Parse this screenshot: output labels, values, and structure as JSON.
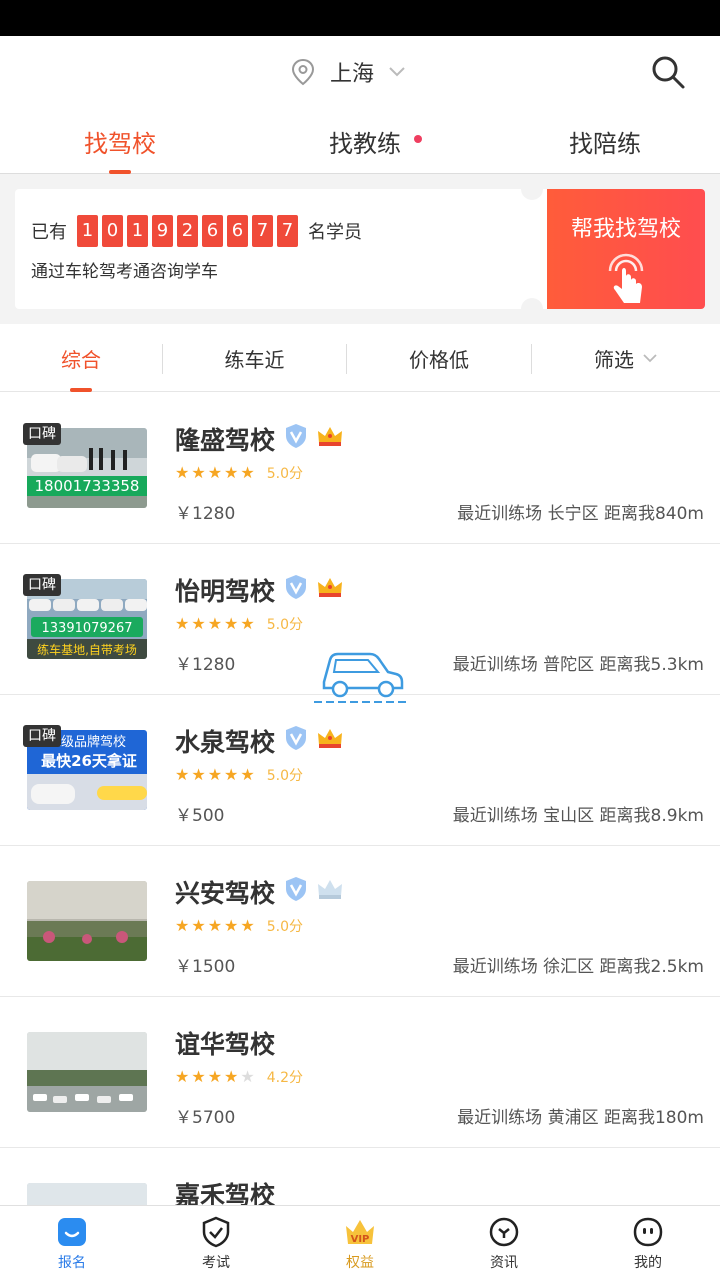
{
  "header": {
    "city": "上海"
  },
  "tabs": [
    {
      "label": "找驾校",
      "active": true
    },
    {
      "label": "找教练",
      "dot": true
    },
    {
      "label": "找陪练"
    }
  ],
  "banner": {
    "prefix": "已有",
    "digits": [
      "1",
      "0",
      "1",
      "9",
      "2",
      "6",
      "6",
      "7",
      "7"
    ],
    "suffix": "名学员",
    "subtitle": "通过车轮驾考通咨询学车",
    "button": "帮我找驾校"
  },
  "filters": [
    "综合",
    "练车近",
    "价格低",
    "筛选"
  ],
  "schools": [
    {
      "name": "隆盛驾校",
      "verified": true,
      "crown": "gold",
      "koubei": "口碑",
      "rating": 5,
      "score": "5.0分",
      "price": "￥1280",
      "location": "最近训练场 长宁区 距离我840m",
      "phone": "18001733358"
    },
    {
      "name": "怡明驾校",
      "verified": true,
      "crown": "gold",
      "koubei": "口碑",
      "rating": 5,
      "score": "5.0分",
      "price": "￥1280",
      "location": "最近训练场 普陀区 距离我5.3km",
      "phone": "13391079267",
      "tagline": "练车基地,自带考场"
    },
    {
      "name": "水泉驾校",
      "verified": true,
      "crown": "gold",
      "koubei": "口碑",
      "rating": 5,
      "score": "5.0分",
      "price": "￥500",
      "location": "最近训练场 宝山区 距离我8.9km",
      "promo1": "A级品牌驾校",
      "promo2": "最快26天拿证"
    },
    {
      "name": "兴安驾校",
      "verified": true,
      "crown": "silver",
      "rating": 5,
      "score": "5.0分",
      "price": "￥1500",
      "location": "最近训练场 徐汇区 距离我2.5km"
    },
    {
      "name": "谊华驾校",
      "rating": 4,
      "score": "4.2分",
      "price": "￥5700",
      "location": "最近训练场 黄浦区 距离我180m"
    },
    {
      "name": "嘉禾驾校"
    }
  ],
  "bottom_nav": [
    {
      "label": "报名",
      "icon": "signup-icon",
      "active": true
    },
    {
      "label": "考试",
      "icon": "exam-shield-icon"
    },
    {
      "label": "权益",
      "icon": "vip-crown-icon"
    },
    {
      "label": "资讯",
      "icon": "news-icon"
    },
    {
      "label": "我的",
      "icon": "profile-face-icon"
    }
  ],
  "colors": {
    "accent": "#f0522b",
    "star": "#f6a623",
    "nav_active": "#2b7ce8"
  }
}
